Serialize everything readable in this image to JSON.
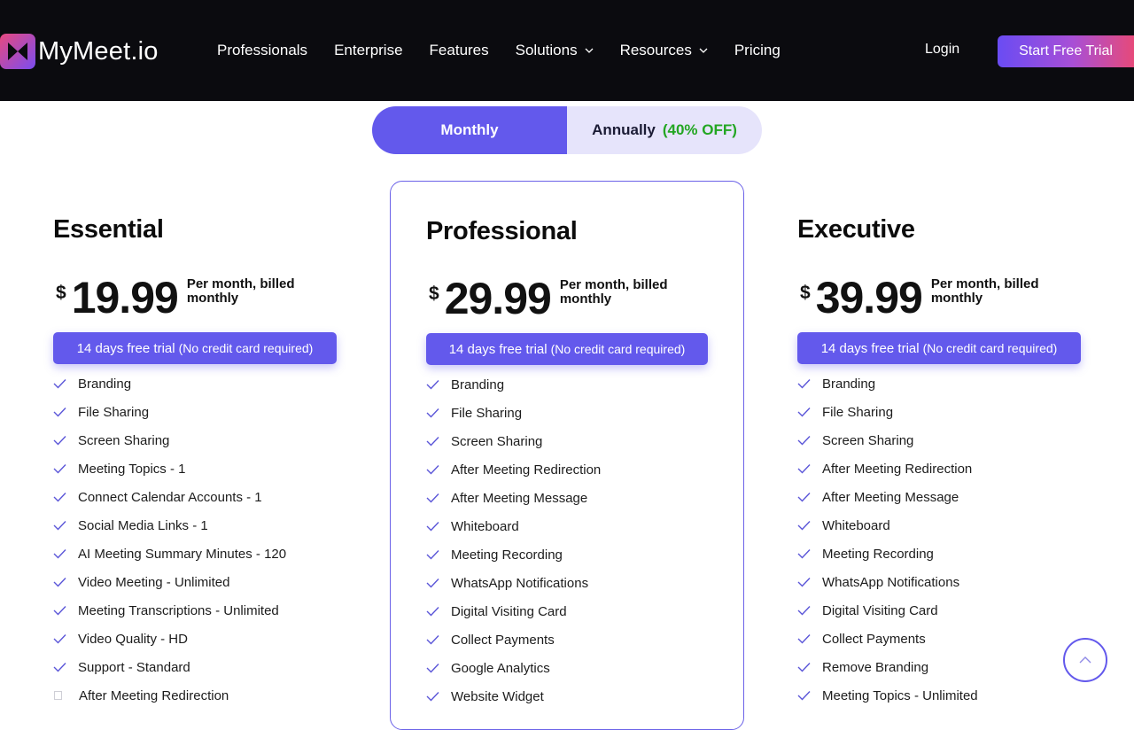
{
  "nav": {
    "logo_text": "MyMeet.io",
    "links": [
      {
        "label": "Professionals"
      },
      {
        "label": "Enterprise"
      },
      {
        "label": "Features"
      },
      {
        "label": "Solutions"
      },
      {
        "label": "Resources"
      },
      {
        "label": "Pricing"
      }
    ],
    "login": "Login",
    "cta": "Start Free Trial"
  },
  "billing_toggle": {
    "monthly": "Monthly",
    "annually": "Annually",
    "annually_discount": "(40% OFF)"
  },
  "plans": [
    {
      "name": "Essential",
      "currency": "$",
      "price": "19.99",
      "billing": "Per month, billed monthly",
      "trial": "14 days free trial",
      "trial_note": "(No credit card required)",
      "features": [
        "Branding",
        "File Sharing",
        "Screen Sharing",
        "Meeting Topics - 1",
        "Connect Calendar Accounts - 1",
        "Social Media Links - 1",
        "AI Meeting Summary Minutes - 120",
        "Video Meeting - Unlimited",
        "Meeting Transcriptions - Unlimited",
        "Video Quality - HD",
        "Support - Standard",
        "After Meeting Redirection"
      ]
    },
    {
      "name": "Professional",
      "currency": "$",
      "price": "29.99",
      "billing": "Per month, billed monthly",
      "trial": "14 days free trial",
      "trial_note": "(No credit card required)",
      "features": [
        "Branding",
        "File Sharing",
        "Screen Sharing",
        "After Meeting Redirection",
        "After Meeting Message",
        "Whiteboard",
        "Meeting Recording",
        "WhatsApp Notifications",
        "Digital Visiting Card",
        "Collect Payments",
        "Google Analytics",
        "Website Widget"
      ]
    },
    {
      "name": "Executive",
      "currency": "$",
      "price": "39.99",
      "billing": "Per month, billed monthly",
      "trial": "14 days free trial",
      "trial_note": "(No credit card required)",
      "features": [
        "Branding",
        "File Sharing",
        "Screen Sharing",
        "After Meeting Redirection",
        "After Meeting Message",
        "Whiteboard",
        "Meeting Recording",
        "WhatsApp Notifications",
        "Digital Visiting Card",
        "Collect Payments",
        "Remove Branding",
        "Meeting Topics - Unlimited"
      ]
    }
  ],
  "colors": {
    "accent": "#6359ec",
    "nav_bg": "#0b0b0f",
    "discount_green": "#23a623"
  }
}
